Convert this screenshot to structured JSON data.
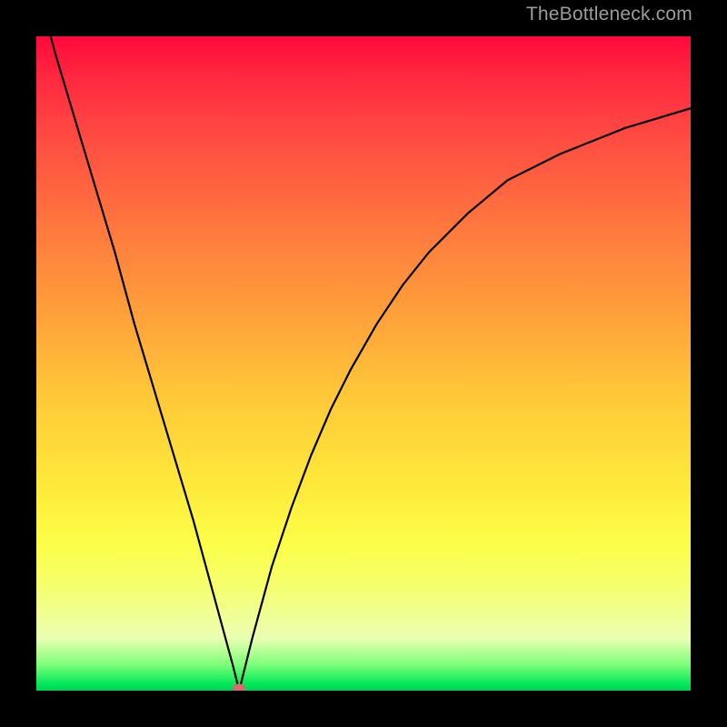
{
  "watermark": "TheBottleneck.com",
  "colors": {
    "curve": "#000000",
    "marker": "#d96a6d",
    "top_gradient": "#ff0a3a",
    "bottom_gradient": "#00d257"
  },
  "chart_data": {
    "type": "line",
    "title": "",
    "xlabel": "",
    "ylabel": "",
    "xlim": [
      0,
      100
    ],
    "ylim": [
      0,
      100
    ],
    "grid": false,
    "legend": false,
    "minimum_x": 31,
    "series": [
      {
        "name": "bottleneck-curve",
        "x": [
          0,
          3,
          6,
          9,
          12,
          15,
          18,
          21,
          24,
          27,
          30,
          31,
          33,
          36,
          39,
          42,
          45,
          48,
          52,
          56,
          60,
          66,
          72,
          80,
          90,
          100
        ],
        "y": [
          108,
          97,
          87,
          77,
          67,
          56,
          46,
          36,
          26,
          15,
          4,
          0,
          8,
          19,
          28,
          36,
          43,
          49,
          56,
          62,
          67,
          73,
          78,
          82,
          86,
          89
        ]
      }
    ],
    "annotations": [
      {
        "type": "marker",
        "x": 31,
        "y": 0,
        "shape": "ellipse",
        "color": "#d96a6d"
      }
    ]
  }
}
